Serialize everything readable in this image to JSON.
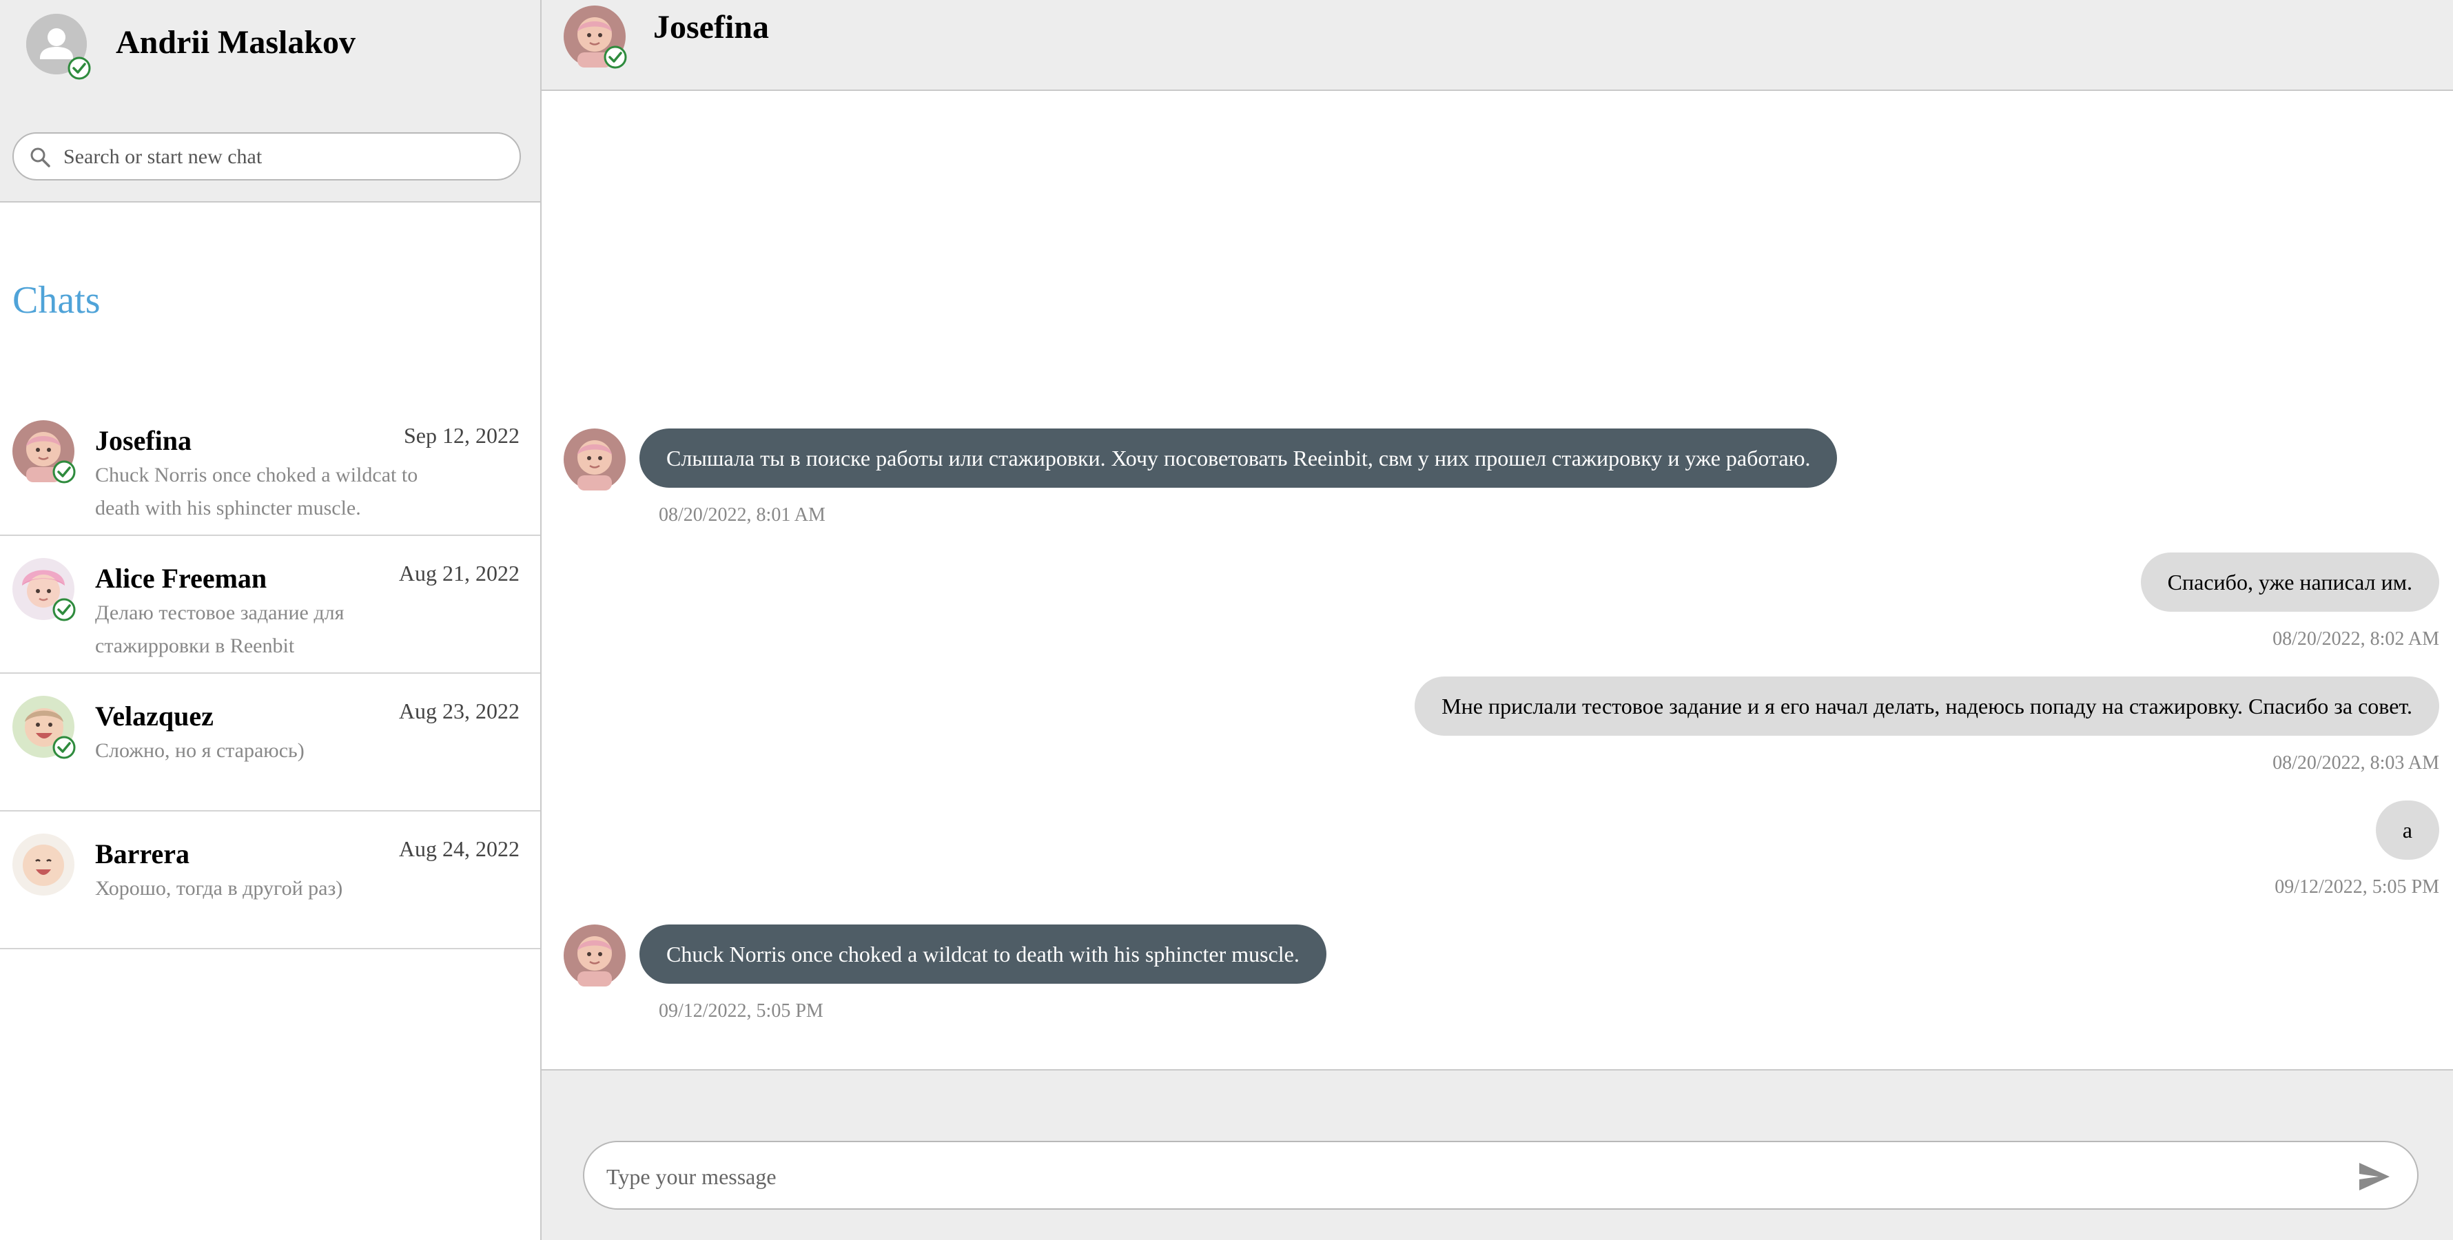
{
  "profile": {
    "name": "Andrii Maslakov",
    "online": true
  },
  "search": {
    "placeholder": "Search or start new chat"
  },
  "chats_title": "Chats",
  "chats": [
    {
      "name": "Josefina",
      "date": "Sep 12, 2022",
      "preview": "Chuck Norris once choked a wildcat to death with his sphincter muscle.",
      "online": true
    },
    {
      "name": "Alice Freeman",
      "date": "Aug 21, 2022",
      "preview": "Делаю тестовое задание для стажирровки в Reenbit",
      "online": true
    },
    {
      "name": "Velazquez",
      "date": "Aug 23, 2022",
      "preview": "Сложно, но я стараюсь)",
      "online": true
    },
    {
      "name": "Barrera",
      "date": "Aug 24, 2022",
      "preview": "Хорошо, тогда в другой раз)",
      "online": false
    }
  ],
  "active_chat": {
    "name": "Josefina",
    "online": true
  },
  "messages": [
    {
      "direction": "in",
      "text": "Слышала ты в поиске работы или стажировки. Хочу посоветовать Reeinbit, свм у них прошел стажировку и уже работаю.",
      "time": "08/20/2022, 8:01 AM"
    },
    {
      "direction": "out",
      "text": "Спасибо, уже написал им.",
      "time": "08/20/2022, 8:02 AM"
    },
    {
      "direction": "out",
      "text": "Мне прислали тестовое задание и я его начал делать, надеюсь попаду на стажировку. Спасибо за совет.",
      "time": "08/20/2022, 8:03 AM"
    },
    {
      "direction": "out",
      "text": "a",
      "time": "09/12/2022, 5:05 PM"
    },
    {
      "direction": "in",
      "text": "Chuck Norris once choked a wildcat to death with his sphincter muscle.",
      "time": "09/12/2022, 5:05 PM"
    }
  ],
  "composer": {
    "placeholder": "Type your message"
  },
  "colors": {
    "accent": "#4fa3d8",
    "incoming_bubble": "#4f5d66",
    "outgoing_bubble": "#dcdcdc",
    "online_check": "#2e8b3d",
    "panel_bg": "#ededed"
  },
  "icons": {
    "search": "search-icon",
    "send": "send-icon",
    "online": "check-circle-icon",
    "default_avatar": "person-icon"
  }
}
